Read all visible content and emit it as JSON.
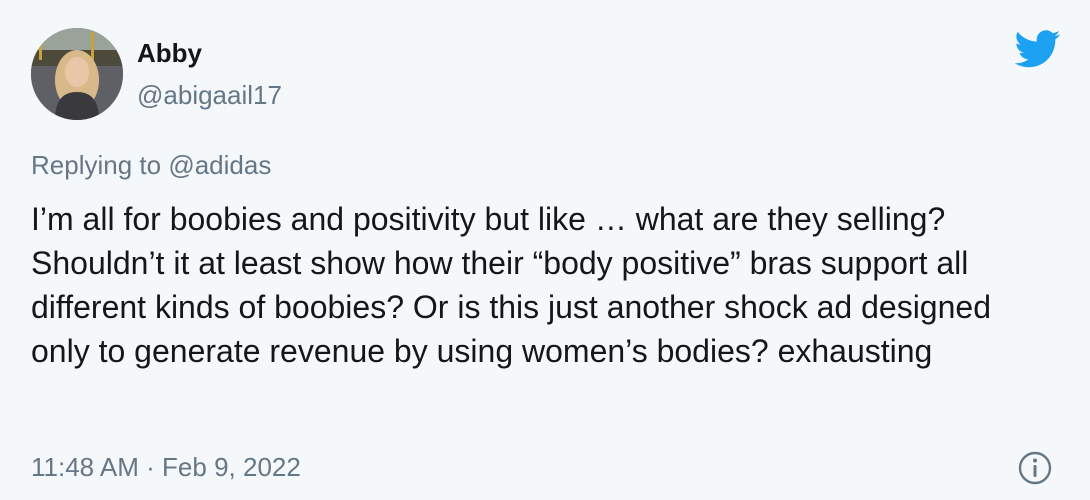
{
  "author": {
    "name": "Abby",
    "handle": "@abigaail17"
  },
  "reply": {
    "prefix": "Replying to ",
    "mention": "@adidas"
  },
  "tweet": {
    "text": "I’m all for boobies and positivity but like … what are they selling? Shouldn’t it at least show how their “body positive” bras support all different kinds of boobies? Or is this just another shock ad designed only to generate revenue by using women’s bodies? exhausting"
  },
  "meta": {
    "time": "11:48 AM",
    "separator": " · ",
    "date": "Feb 9, 2022"
  },
  "icons": {
    "brand": "twitter-bird-icon",
    "info": "info-icon"
  },
  "colors": {
    "twitter_blue": "#1da1f2",
    "secondary_text": "#657786",
    "primary_text": "#14171a",
    "background": "#f5f8fa"
  }
}
